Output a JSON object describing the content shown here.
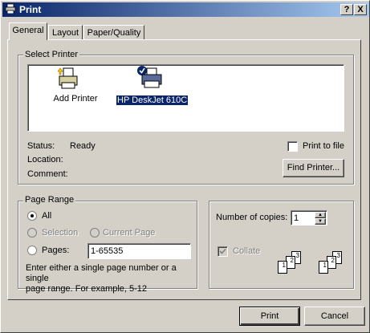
{
  "window": {
    "title": "Print"
  },
  "titlebar": {
    "help": "?",
    "close": "X"
  },
  "tabs": [
    {
      "label": "General",
      "active": true
    },
    {
      "label": "Layout",
      "active": false
    },
    {
      "label": "Paper/Quality",
      "active": false
    }
  ],
  "select_printer": {
    "legend": "Select Printer",
    "printers": [
      {
        "label": "Add Printer",
        "icon": "add-printer-icon",
        "selected": false
      },
      {
        "label": "HP DeskJet 610C",
        "icon": "printer-icon",
        "selected": true
      }
    ],
    "status_label": "Status:",
    "status_value": "Ready",
    "location_label": "Location:",
    "comment_label": "Comment:",
    "print_to_file_label": "Print to file",
    "print_to_file_checked": false,
    "find_printer_label": "Find Printer..."
  },
  "page_range": {
    "legend": "Page Range",
    "all_label": "All",
    "selection_label": "Selection",
    "current_page_label": "Current Page",
    "pages_label": "Pages:",
    "pages_value": "1-65535",
    "hint_line1": "Enter either a single page number or a single",
    "hint_line2": "page range.  For example, 5-12",
    "selected": "All"
  },
  "copies": {
    "number_label": "Number of copies:",
    "number_value": "1",
    "collate_label": "Collate",
    "collate_checked": true,
    "collate_page_numbers": [
      "1",
      "2",
      "3"
    ]
  },
  "buttons": {
    "print": "Print",
    "cancel": "Cancel"
  },
  "colors": {
    "titlebar_start": "#0a246a",
    "titlebar_end": "#a6caf0",
    "face": "#d4d0c8",
    "selection": "#0a246a"
  }
}
